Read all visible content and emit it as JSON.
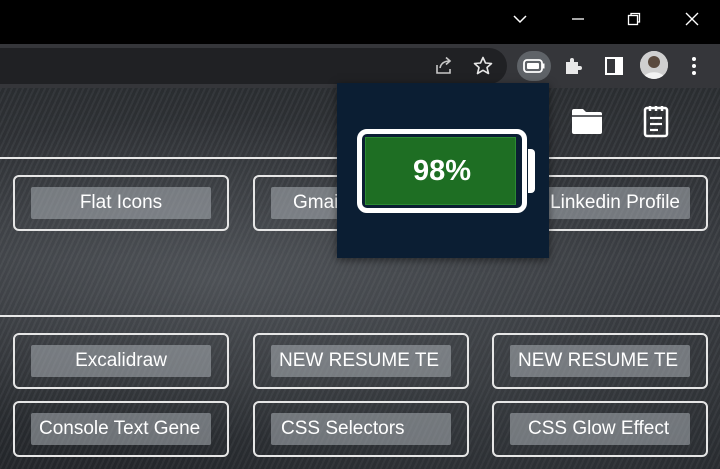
{
  "window_controls": {
    "tab_search": "chevron-down-icon",
    "minimize": "minimize-icon",
    "restore": "restore-icon",
    "close": "close-icon"
  },
  "toolbar": {
    "icons": [
      "share-icon",
      "bookmark-star-icon",
      "battery-extension-icon",
      "puzzle-extensions-icon",
      "side-panel-icon",
      "profile-avatar",
      "menu-kebab-icon"
    ]
  },
  "battery_popup": {
    "label": "98%",
    "level": 0.98,
    "fill_color": "#1e6e23",
    "background_color": "#0b1e33"
  },
  "header_icons": [
    "folder-icon",
    "notepad-icon"
  ],
  "links": {
    "row1": [
      "Flat Icons",
      "Gmail",
      "Linkedin Profile"
    ],
    "row2": [
      "Excalidraw",
      "NEW RESUME TE",
      "NEW RESUME TE"
    ],
    "row3": [
      "Console Text Gene",
      "CSS Selectors",
      "CSS Glow Effect"
    ]
  }
}
